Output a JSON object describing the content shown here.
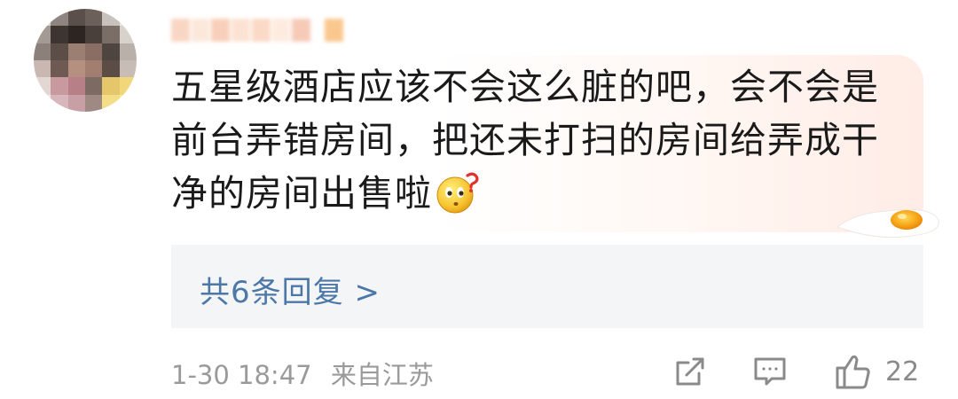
{
  "comment": {
    "username": "",
    "content": "五星级酒店应该不会这么脏的吧，会不会是前台弄错房间，把还未打扫的房间给弄成干净的房间出售啦",
    "content_emoji": "think-question-emoji",
    "replies": {
      "label": "共6条回复 >"
    },
    "meta": {
      "time": "1-30 18:47",
      "location": "来自江苏"
    },
    "actions": {
      "share_icon": "share-icon",
      "comment_icon": "comment-icon",
      "like_icon": "thumbs-up-icon",
      "like_count": "22"
    }
  },
  "colors": {
    "link": "#4c78a8",
    "meta": "#9a9a9a",
    "text": "#1a1a1a",
    "reply_bg": "#f4f5f7"
  }
}
